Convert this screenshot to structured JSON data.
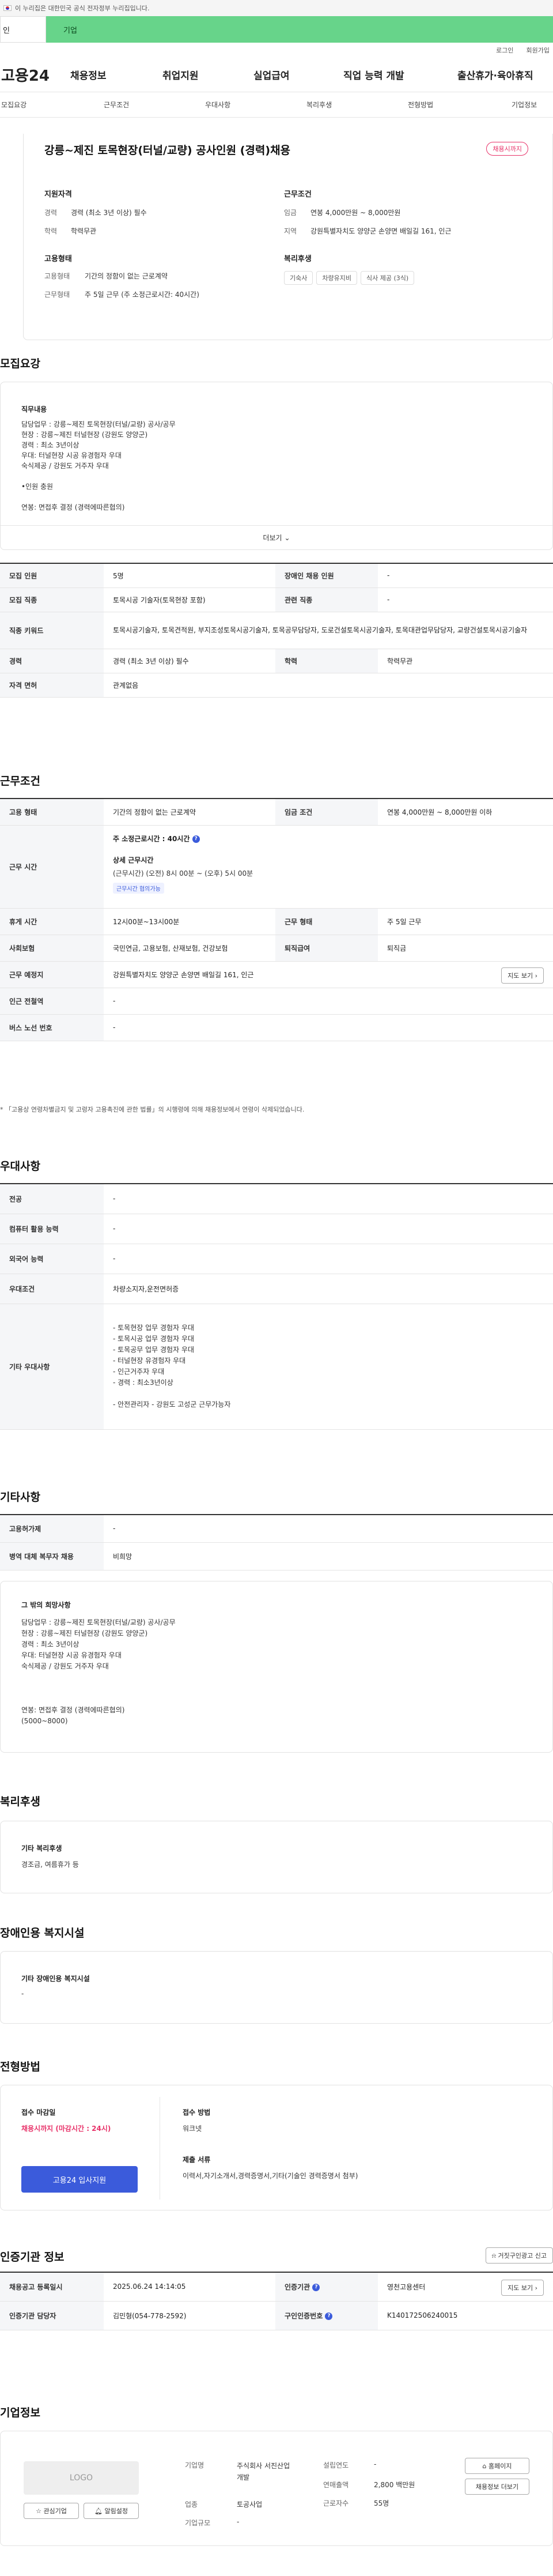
{
  "gov_banner": "이 누리집은 대한민국 공식 전자정부 누리집입니다.",
  "top_tabs": [
    "고용24 (개인)",
    "기업"
  ],
  "top_tabs_visible": [
    "인",
    "기업"
  ],
  "util_links": [
    "로그인",
    "회원가입"
  ],
  "logo": "고용24",
  "gnb": [
    "채용정보",
    "취업지원",
    "실업급여",
    "직업 능력 개발",
    "출산휴가·육아휴직"
  ],
  "subnav": [
    "모집요강",
    "근무조건",
    "우대사항",
    "복리후생",
    "전형방법",
    "기업정보"
  ],
  "job_title": "강릉~제진 토목현장(터널/교량) 공사인원 (경력)채용",
  "status_badge": "채용시까지",
  "summary": {
    "qual_title": "지원자격",
    "qual": [
      [
        "경력",
        "경력 (최소 3년 이상) 필수"
      ],
      [
        "학력",
        "학력무관"
      ]
    ],
    "emp_title": "고용형태",
    "emp": [
      [
        "고용형태",
        "기간의 정함이 없는 근로계약"
      ],
      [
        "근무형태",
        "주 5일 근무 (주 소정근로시간: 40시간)"
      ]
    ],
    "cond_title": "근무조건",
    "cond": [
      [
        "임금",
        "연봉 4,000만원 ~ 8,000만원"
      ],
      [
        "지역",
        "강원특별자치도 양양군 손양면 배일길 161, 인근"
      ]
    ],
    "welfare_title": "복리후생",
    "welfare_tags": [
      "기숙사",
      "차량유지비",
      "식사 제공 (3식)"
    ]
  },
  "recruit": {
    "title": "모집요강",
    "duty_title": "직무내용",
    "duty_text": "담당업무 : 강릉~제진 토목현장(터널/교량) 공사/공무\n현장 : 강릉~제진 터널현장 (강원도 양양군)\n경력 : 최소 3년이상\n우대: 터널현장 시공 유경험자 우대\n        숙식제공 / 강원도 거주자 우대\n\n•인원 충원\n\n연봉: 면접후 결정 (경력에따른협의)",
    "more_label": "더보기",
    "table": {
      "r1": [
        "모집 인원",
        "5명",
        "장애인 채용 인원",
        "-"
      ],
      "r2": [
        "모집 직종",
        "토목시공 기술자(토목현장 포함)",
        "관련 직종",
        "-"
      ],
      "r3": [
        "직종 키워드",
        "토목시공기술자, 토목견적원, 부지조성토목시공기술자, 토목공무담당자, 도로건설토목시공기술자, 토목대관업무담당자, 교량건설토목시공기술자"
      ],
      "r4": [
        "경력",
        "경력 (최소 3년 이상) 필수",
        "학력",
        "학력무관"
      ],
      "r5": [
        "자격 면허",
        "관계없음"
      ]
    }
  },
  "work": {
    "title": "근무조건",
    "r1": [
      "고용 형태",
      "기간의 정함이 없는 근로계약",
      "임금 조건",
      "연봉 4,000만원 ~ 8,000만원 이하"
    ],
    "hours_label": "근무 시간",
    "hours_weekly": "주 소정근로시간  : 40시간",
    "hours_detail_title": "상세 근무시간",
    "hours_detail": "(근무시간) (오전) 8시 00분 ~ (오후) 5시 00분",
    "hours_tag": "근무시간 협의가능",
    "r3": [
      "휴게 시간",
      "12시00분~13시00분",
      "근무 형태",
      "주 5일 근무"
    ],
    "r4": [
      "사회보험",
      "국민연금, 고용보험, 산재보험, 건강보험",
      "퇴직급여",
      "퇴직금"
    ],
    "r5": [
      "근무 예정지",
      "강원특별자치도 양양군 손양면 배일길 161, 인근"
    ],
    "map_button": "지도 보기",
    "r6": [
      "인근 전철역",
      "-"
    ],
    "r7": [
      "버스 노선 번호",
      "-"
    ],
    "note": "* 「고용상 연령차별금지 및 고령자 고용촉진에 관한 법률」의 시행령에 의해 채용정보에서 연령이 삭제되었습니다."
  },
  "pref": {
    "title": "우대사항",
    "r1": [
      "전공",
      "-"
    ],
    "r2": [
      "컴퓨터 활용 능력",
      "-"
    ],
    "r3": [
      "외국어 능력",
      "-"
    ],
    "r4": [
      "우대조건",
      "차량소지자,운전면허증"
    ],
    "r5_label": "기타 우대사항",
    "r5_text": "- 토목현장 업무 경험자 우대\n- 토목시공 업무 경험자 우대\n- 토목공무 업무 경험자 우대\n- 터널현장 유경험자 우대\n- 인근거주자 우대\n- 경력 : 최소3년이상\n\n- 안전관리자 - 강원도 고성군 근무가능자"
  },
  "etc": {
    "title": "기타사항",
    "r1": [
      "고용허가제",
      "-"
    ],
    "r2": [
      "병역 대체 복무자 채용",
      "비희망"
    ],
    "box_title": "그 밖의 희망사항",
    "box_text": "담당업무 : 강릉~제진 토목현장(터널/교량) 공사/공무\n현장 : 강릉~제진 터널현장 (강원도 양양군)\n경력 : 최소 3년이상\n우대: 터널현장 시공 유경험자 우대\n        숙식제공 / 강원도 거주자 우대\n\n\n\n연봉: 면접후 결정 (경력에따른협의)\n        (5000~8000)"
  },
  "welfare": {
    "title": "복리후생",
    "box_title": "기타 복리후생",
    "box_text": "경조금, 여름휴가 등"
  },
  "disability": {
    "title": "장애인용 복지시설",
    "box_title": "기타 장애인용 복지시설",
    "box_text": "-"
  },
  "selection": {
    "title": "전형방법",
    "deadline_title": "접수 마감일",
    "deadline": "채용시까지 (마감시간 : 24시)",
    "apply_button": "고용24 입사지원",
    "method_title": "접수 방법",
    "method": "워크넷",
    "docs_title": "제출 서류",
    "docs": "이력서,자기소개서,경력증명서,기타(기술인 경력증명서 첨부)"
  },
  "cert": {
    "title": "인증기관 정보",
    "report_button": "거짓구인광고 신고",
    "r1": [
      "채용공고 등록일시",
      "2025.06.24 14:14:05",
      "인증기관",
      "영천고용센터"
    ],
    "map_button": "지도 보기",
    "r2": [
      "인증기관 담당자",
      "김민형(054-778-2592)",
      "구인인증번호",
      "K140172506240015"
    ]
  },
  "company": {
    "title": "기업정보",
    "logo_text": "LOGO",
    "fav_button": "관심기업",
    "noti_button": "알림설정",
    "name_label": "기업명",
    "name": "주식회사 서진산업개발",
    "industry_label": "업종",
    "industry": "토공사업",
    "size_label": "기업규모",
    "size": "-",
    "year_label": "설립연도",
    "year": "-",
    "sales_label": "연매출액",
    "sales": "2,800 백만원",
    "emp_label": "근로자수",
    "emp": "55명",
    "homepage_button": "홈페이지",
    "jobs_button": "채용정보 더보기"
  }
}
